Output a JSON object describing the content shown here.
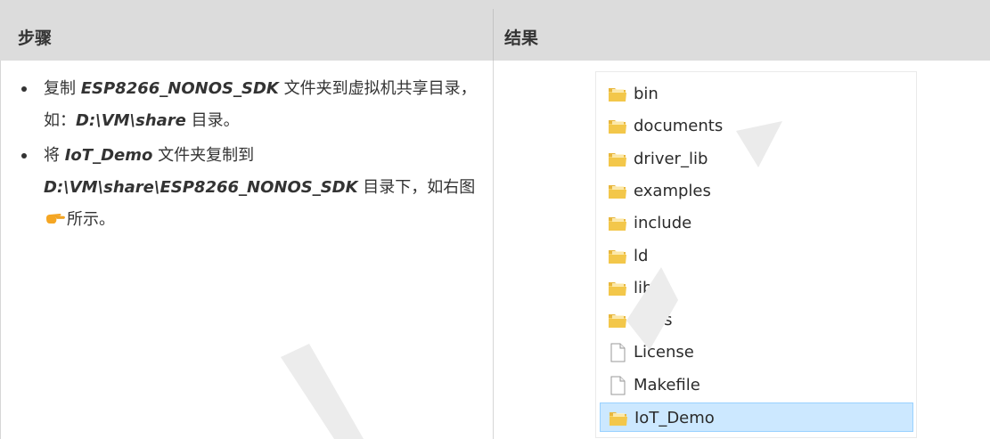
{
  "header": {
    "steps_label": "步骤",
    "result_label": "结果"
  },
  "steps": {
    "step1": {
      "t1": "复制 ",
      "em1": "ESP8266_NONOS_SDK",
      "t2": " 文件夹到虚拟机共享目录，如：",
      "em2": "D:\\VM\\share",
      "t3": " 目录。"
    },
    "step2": {
      "t1": "将 ",
      "em1": "IoT_Demo",
      "t2": " 文件夹复制到 ",
      "em2": "D:\\VM\\share\\ESP8266_NONOS_SDK",
      "t3": " 目录下，如右图",
      "icon": "pointing-hand-icon",
      "t4": "所示。"
    }
  },
  "explorer": {
    "items": [
      {
        "label": "bin",
        "icon": "folder-icon"
      },
      {
        "label": "documents",
        "icon": "folder-icon"
      },
      {
        "label": "driver_lib",
        "icon": "folder-icon"
      },
      {
        "label": "examples",
        "icon": "folder-icon"
      },
      {
        "label": "include",
        "icon": "folder-icon"
      },
      {
        "label": "ld",
        "icon": "folder-icon"
      },
      {
        "label": "lib",
        "icon": "folder-icon"
      },
      {
        "label": "tools",
        "icon": "folder-icon"
      },
      {
        "label": "License",
        "icon": "file-icon"
      },
      {
        "label": "Makefile",
        "icon": "file-icon"
      },
      {
        "label": "IoT_Demo",
        "icon": "folder-icon",
        "selected": true
      }
    ]
  },
  "colors": {
    "header_bg": "#dcdcdc",
    "selection_bg": "#cce8ff",
    "selection_border": "#99d1ff",
    "folder_yellow": "#f3c74a",
    "pointer_orange": "#f5a623",
    "watermark_gray": "#ececec"
  }
}
